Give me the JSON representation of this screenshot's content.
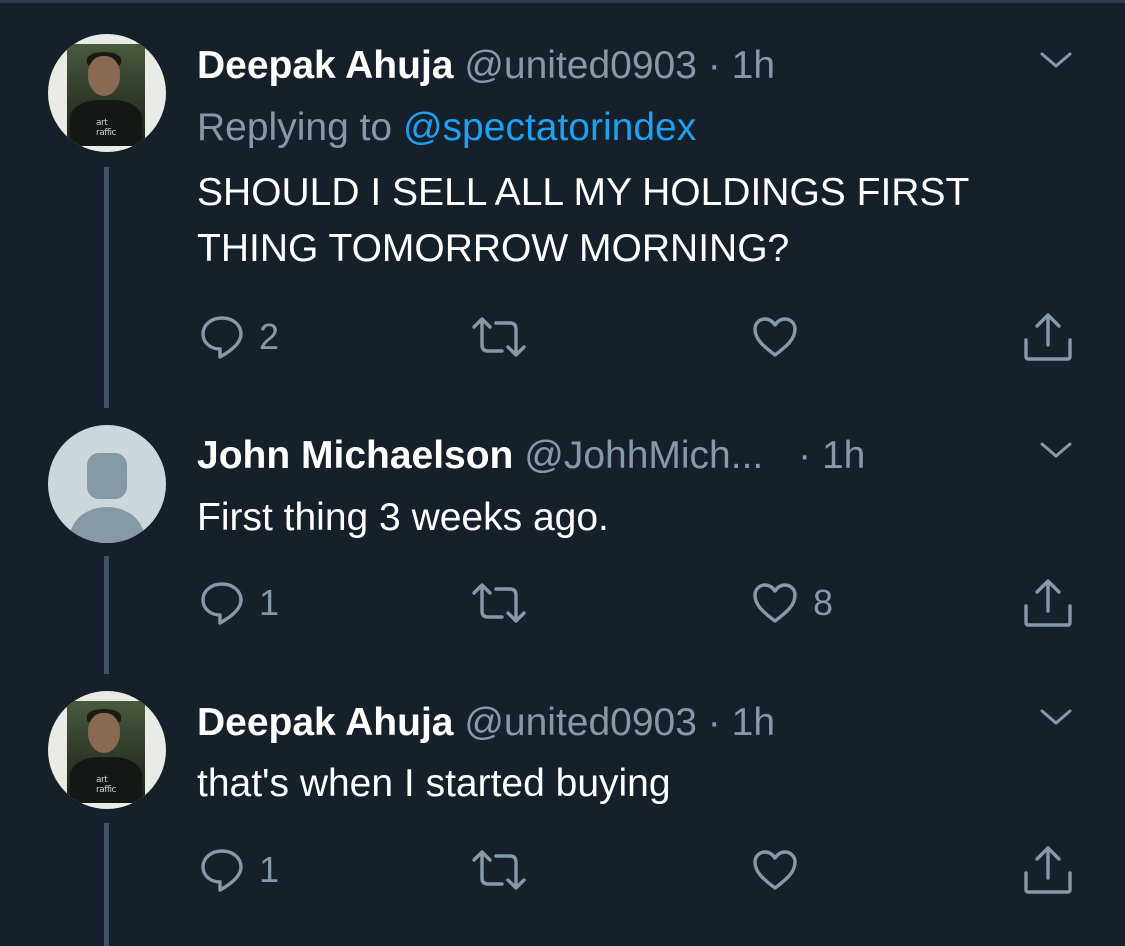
{
  "tweets": [
    {
      "name": "Deepak Ahuja",
      "handle": "@united0903",
      "separator": "·",
      "time": "1h",
      "reply_prefix": "Replying to",
      "reply_mention": "@spectatorindex",
      "text_lines": [
        "SHOULD I SELL ALL MY HOLDINGS FIRST",
        "THING TOMORROW MORNING?"
      ],
      "avatar": "profile-photo",
      "shirt_text": "art\nraffic",
      "reply_count": "2",
      "retweet_count": "",
      "like_count": ""
    },
    {
      "name": "John Michaelson",
      "handle": "@JohhMich...",
      "separator": "·",
      "time": "1h",
      "text_lines": [
        "First thing 3 weeks ago."
      ],
      "avatar": "default-avatar",
      "reply_count": "1",
      "retweet_count": "",
      "like_count": "8"
    },
    {
      "name": "Deepak Ahuja",
      "handle": "@united0903",
      "separator": "·",
      "time": "1h",
      "text_lines": [
        "that's when I started buying"
      ],
      "avatar": "profile-photo",
      "shirt_text": "art\nraffic",
      "reply_count": "1",
      "retweet_count": "",
      "like_count": ""
    }
  ],
  "icons": {
    "reply": "reply-icon",
    "retweet": "retweet-icon",
    "like": "heart-icon",
    "share": "share-icon",
    "menu": "chevron-down-icon"
  },
  "colors": {
    "background": "#15202b",
    "primary_text": "#ffffff",
    "secondary_text": "#8899a6",
    "link": "#1da1f2",
    "thread_line": "#3d5466"
  }
}
